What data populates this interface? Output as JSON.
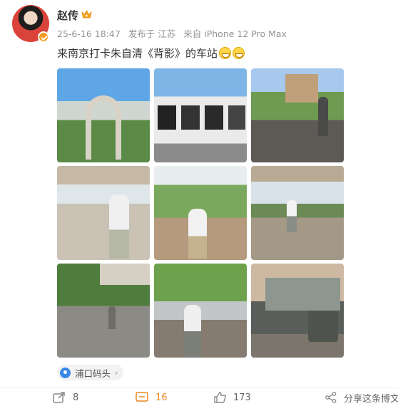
{
  "user": {
    "name": "赵传",
    "badge_icon": "crown-icon",
    "avatar_icon": "avatar"
  },
  "meta": {
    "date": "25-6-16 18:47",
    "posted_from": "发布于 江苏",
    "device": "来自 iPhone 12 Pro Max"
  },
  "post": {
    "text": "来南京打卡朱自清《背影》的车站",
    "emoji": [
      "grin-emoji",
      "grin-emoji"
    ]
  },
  "photos": [
    {
      "subject": "archway gate"
    },
    {
      "subject": "photo exhibition panels"
    },
    {
      "subject": "statue and old building"
    },
    {
      "subject": "man on platform"
    },
    {
      "subject": "man pointing by tracks"
    },
    {
      "subject": "man walking on platform"
    },
    {
      "subject": "man walking along platform"
    },
    {
      "subject": "man standing by tracks"
    },
    {
      "subject": "iron bench sculpture"
    }
  ],
  "location": {
    "label": "浦口码头",
    "icon": "location-pin-icon"
  },
  "actions": {
    "share_count": "8",
    "comment_count": "16",
    "like_count": "173",
    "forward_label": "分享这条博文"
  },
  "colors": {
    "comment_active": "#e8871e",
    "location_pin": "#3a86e8"
  }
}
